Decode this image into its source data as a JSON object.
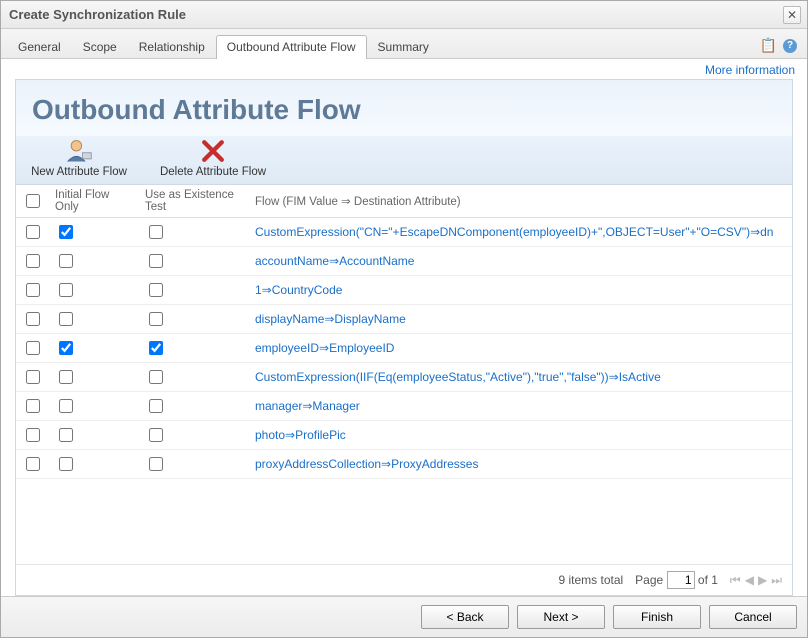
{
  "dialog": {
    "title": "Create Synchronization Rule"
  },
  "tabs": [
    {
      "label": "General"
    },
    {
      "label": "Scope"
    },
    {
      "label": "Relationship"
    },
    {
      "label": "Outbound Attribute Flow",
      "active": true
    },
    {
      "label": "Summary"
    }
  ],
  "more_info": "More information",
  "panel": {
    "heading": "Outbound Attribute Flow"
  },
  "toolbar": {
    "new_label": "New Attribute Flow",
    "delete_label": "Delete Attribute Flow"
  },
  "columns": {
    "initial_flow_only": "Initial Flow Only",
    "use_as_existence_test": "Use as Existence Test",
    "flow": "Flow (FIM Value ⇒ Destination Attribute)"
  },
  "rows": [
    {
      "ifo": true,
      "uet": false,
      "flow": "CustomExpression(\"CN=\"+EscapeDNComponent(employeeID)+\",OBJECT=User\"+\"O=CSV\")⇒dn"
    },
    {
      "ifo": false,
      "uet": false,
      "flow": "accountName⇒AccountName"
    },
    {
      "ifo": false,
      "uet": false,
      "flow": "1⇒CountryCode"
    },
    {
      "ifo": false,
      "uet": false,
      "flow": "displayName⇒DisplayName"
    },
    {
      "ifo": true,
      "uet": true,
      "flow": "employeeID⇒EmployeeID"
    },
    {
      "ifo": false,
      "uet": false,
      "flow": "CustomExpression(IIF(Eq(employeeStatus,\"Active\"),\"true\",\"false\"))⇒IsActive"
    },
    {
      "ifo": false,
      "uet": false,
      "flow": "manager⇒Manager"
    },
    {
      "ifo": false,
      "uet": false,
      "flow": "photo⇒ProfilePic"
    },
    {
      "ifo": false,
      "uet": false,
      "flow": "proxyAddressCollection⇒ProxyAddresses"
    }
  ],
  "pager": {
    "items_total": "9 items total",
    "page_label_prefix": "Page",
    "page_value": "1",
    "page_label_suffix": "of 1"
  },
  "footer": {
    "back": "< Back",
    "next": "Next >",
    "finish": "Finish",
    "cancel": "Cancel"
  }
}
